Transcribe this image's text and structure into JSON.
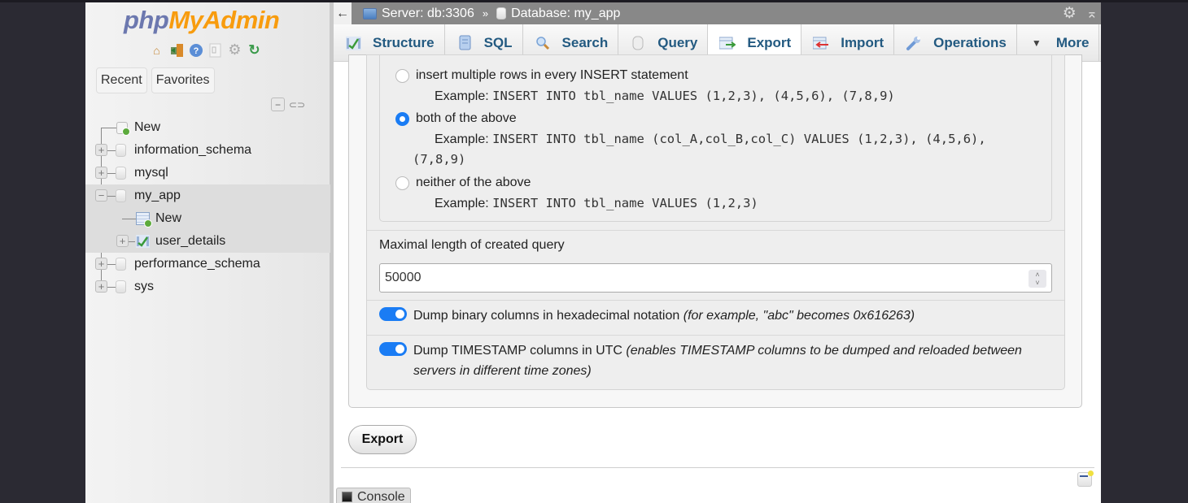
{
  "sidebar": {
    "logo_php": "php",
    "logo_myadmin": "MyAdmin",
    "nav_icons": [
      "home-icon",
      "logout-icon",
      "help-icon",
      "docs-icon",
      "settings-icon",
      "reload-icon"
    ],
    "tabs": [
      {
        "label": "Recent"
      },
      {
        "label": "Favorites"
      }
    ],
    "tree": {
      "new": "New",
      "databases": [
        {
          "name": "information_schema",
          "expanded": false
        },
        {
          "name": "mysql",
          "expanded": false
        },
        {
          "name": "my_app",
          "expanded": true,
          "children": [
            {
              "name": "New"
            },
            {
              "name": "user_details"
            }
          ]
        },
        {
          "name": "performance_schema",
          "expanded": false
        },
        {
          "name": "sys",
          "expanded": false
        }
      ]
    }
  },
  "header": {
    "back": "←",
    "server": "Server: db:3306",
    "separator": "»",
    "database": "Database: my_app"
  },
  "menu": {
    "tabs": [
      {
        "label": "Structure",
        "icon": "structure-icon"
      },
      {
        "label": "SQL",
        "icon": "sql-icon"
      },
      {
        "label": "Search",
        "icon": "search-icon"
      },
      {
        "label": "Query",
        "icon": "query-icon"
      },
      {
        "label": "Export",
        "icon": "export-icon",
        "active": true
      },
      {
        "label": "Import",
        "icon": "import-icon"
      },
      {
        "label": "Operations",
        "icon": "operations-icon"
      },
      {
        "label": "More",
        "icon": "caret-down-icon"
      }
    ]
  },
  "options": {
    "insert_syntax": [
      {
        "label": "insert multiple rows in every INSERT statement",
        "example_label": "Example:",
        "example": "INSERT INTO tbl_name VALUES (1,2,3), (4,5,6), (7,8,9)",
        "checked": false
      },
      {
        "label": "both of the above",
        "example_label": "Example:",
        "example": "INSERT INTO tbl_name (col_A,col_B,col_C) VALUES (1,2,3), (4,5,6),",
        "example_cont": "(7,8,9)",
        "checked": true
      },
      {
        "label": "neither of the above",
        "example_label": "Example:",
        "example": "INSERT INTO tbl_name VALUES (1,2,3)",
        "checked": false
      }
    ],
    "max_query_label": "Maximal length of created query",
    "max_query_value": "50000",
    "hex_binary": {
      "label": "Dump binary columns in hexadecimal notation",
      "note": "(for example, \"abc\" becomes 0x616263)",
      "enabled": true
    },
    "utc_timestamp": {
      "label": "Dump TIMESTAMP columns in UTC",
      "note": "(enables TIMESTAMP columns to be dumped and reloaded between",
      "note_cont": "servers in different time zones)",
      "enabled": true
    }
  },
  "export_button": "Export",
  "console_label": "Console"
}
